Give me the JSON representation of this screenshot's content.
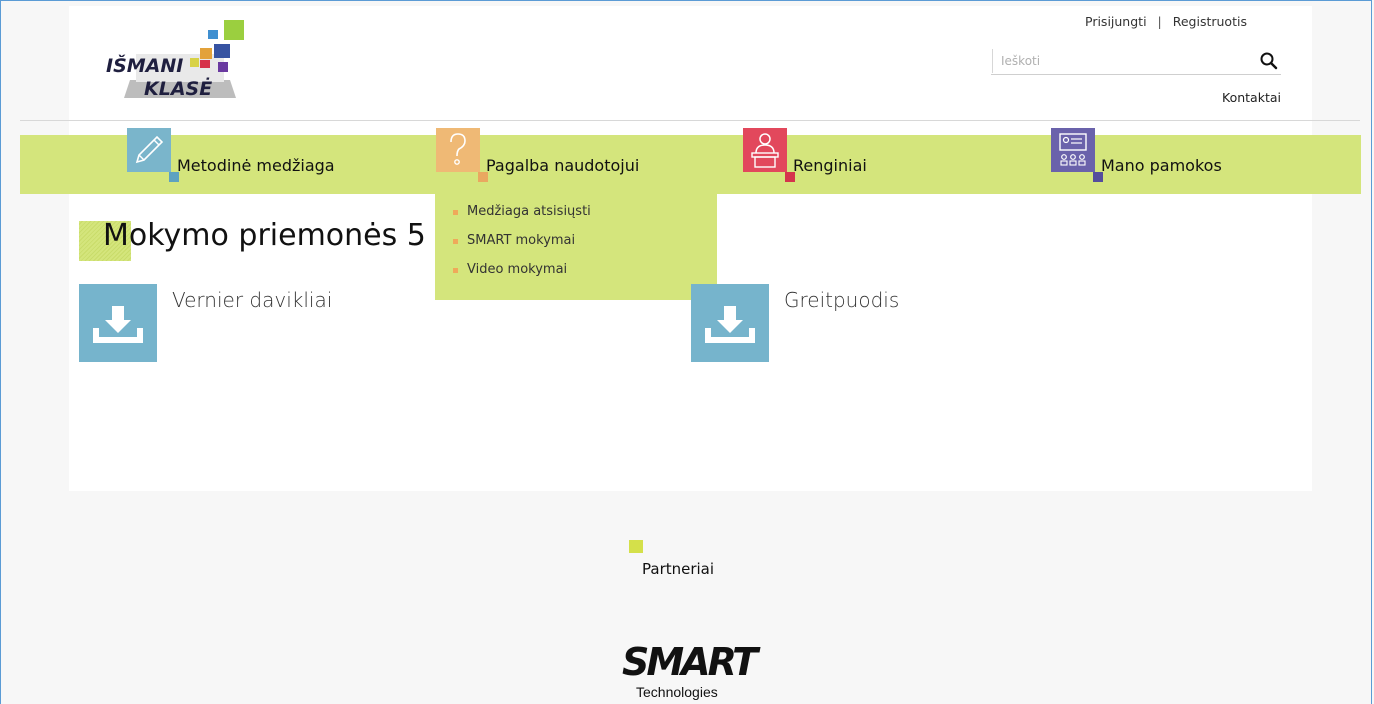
{
  "header": {
    "logo_text_top": "IŠMANI",
    "logo_text_bottom": "KLASĖ",
    "login_label": "Prisijungti",
    "separator": "|",
    "register_label": "Registruotis",
    "search_placeholder": "Ieškoti",
    "search_value": "",
    "contact_label": "Kontaktai"
  },
  "nav": {
    "items": [
      {
        "label": "Metodinė medžiaga",
        "icon": "pencil-icon",
        "color": "#7ab5cb",
        "corner_color": "#5ea2c0"
      },
      {
        "label": "Pagalba naudotojui",
        "icon": "question-icon",
        "color": "#efb975",
        "corner_color": "#e9a860"
      },
      {
        "label": "Renginiai",
        "icon": "presenter-icon",
        "color": "#e2485c",
        "corner_color": "#d5344c"
      },
      {
        "label": "Mano pamokos",
        "icon": "classroom-icon",
        "color": "#6a62ab",
        "corner_color": "#554d9d"
      }
    ],
    "dropdown": [
      "Medžiaga atsisiųsti",
      "SMART mokymai",
      "Video mokymai"
    ]
  },
  "main": {
    "title": "Mokymo priemonės 5",
    "downloads": [
      {
        "label": "Vernier davikliai",
        "icon": "download-icon"
      },
      {
        "label": "Greitpuodis",
        "icon": "download-icon"
      }
    ]
  },
  "footer": {
    "partners_label": "Partneriai",
    "partner_logo_main": "SMART",
    "partner_logo_sub": "Technologies"
  },
  "colors": {
    "nav_bar": "#d4e57c",
    "download_tile": "#76b4cc",
    "bullet": "#efa95a"
  }
}
